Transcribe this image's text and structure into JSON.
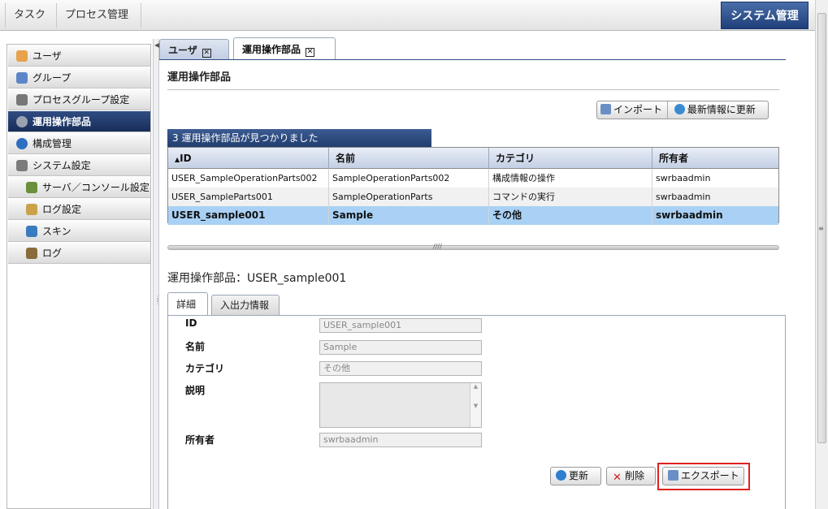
{
  "topbar": {
    "tabs": [
      "タスク",
      "プロセス管理"
    ],
    "system_button": "システム管理"
  },
  "sidebar": {
    "items": [
      {
        "label": "ユーザ",
        "icon": "user-icon",
        "color": "#e8a24a"
      },
      {
        "label": "グループ",
        "icon": "group-icon",
        "color": "#5b87c9"
      },
      {
        "label": "プロセスグループ設定",
        "icon": "tools-icon",
        "color": "#777777"
      },
      {
        "label": "運用操作部品",
        "icon": "gear-icon",
        "color": "#9aa2b0"
      },
      {
        "label": "構成管理",
        "icon": "config-icon",
        "color": "#2f6fc0"
      },
      {
        "label": "システム設定",
        "icon": "settings-icon",
        "color": "#7b7b7b"
      },
      {
        "label": "サーバ／コンソール設定",
        "icon": "server-icon",
        "color": "#6b8f3a"
      },
      {
        "label": "ログ設定",
        "icon": "log-settings-icon",
        "color": "#c9a24a"
      },
      {
        "label": "スキン",
        "icon": "skin-icon",
        "color": "#3a7bbf"
      },
      {
        "label": "ログ",
        "icon": "log-icon",
        "color": "#8a6b3a"
      }
    ]
  },
  "main_tabs": [
    {
      "label": "ユーザ"
    },
    {
      "label": "運用操作部品"
    }
  ],
  "page": {
    "title": "運用操作部品",
    "import_label": "インポート",
    "refresh_label": "最新情報に更新",
    "result_banner": "3 運用操作部品が見つかりました"
  },
  "table": {
    "headers": [
      "ID",
      "名前",
      "カテゴリ",
      "所有者"
    ],
    "rows": [
      [
        "USER_SampleOperationParts002",
        "SampleOperationParts002",
        "構成情報の操作",
        "swrbaadmin"
      ],
      [
        "USER_SampleParts001",
        "SampleOperationParts",
        "コマンドの実行",
        "swrbaadmin"
      ],
      [
        "USER_sample001",
        "Sample",
        "その他",
        "swrbaadmin"
      ]
    ],
    "sort_indicator": "▲"
  },
  "detail": {
    "title": "運用操作部品：USER_sample001",
    "tabs": [
      "詳細",
      "入出力情報"
    ],
    "fields": {
      "id_label": "ID",
      "id_value": "USER_sample001",
      "name_label": "名前",
      "name_value": "Sample",
      "category_label": "カテゴリ",
      "category_value": "その他",
      "desc_label": "説明",
      "owner_label": "所有者",
      "owner_value": "swrbaadmin"
    },
    "buttons": {
      "update": "更新",
      "delete": "削除",
      "export": "エクスポート"
    }
  },
  "colors": {
    "accent": "#1f3f7a",
    "selected_row": "#a9d1f5",
    "highlight": "#e02020"
  }
}
